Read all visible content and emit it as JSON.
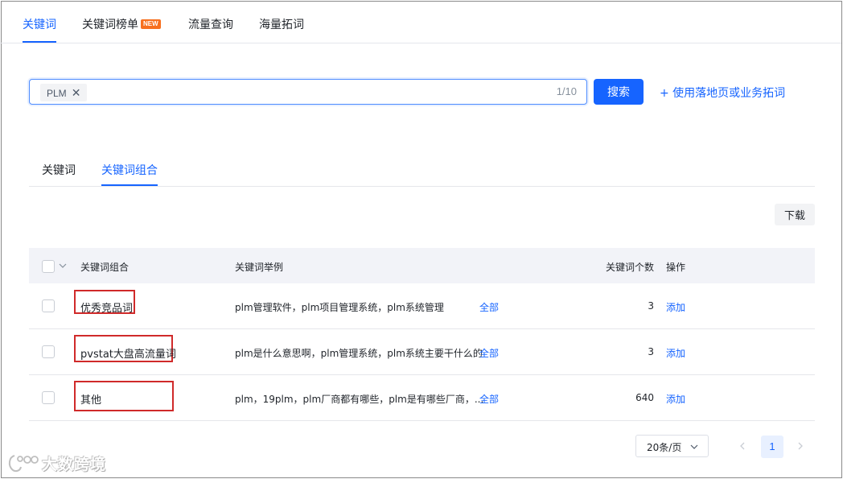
{
  "top_tabs": [
    {
      "label": "关键词",
      "active": true
    },
    {
      "label": "关键词榜单",
      "badge": "NEW"
    },
    {
      "label": "流量查询"
    },
    {
      "label": "海量拓词"
    }
  ],
  "search": {
    "tags": [
      "PLM"
    ],
    "counter": "1/10",
    "button_label": "搜索",
    "expand_link": "+ 使用落地页或业务拓词"
  },
  "sub_tabs": [
    {
      "label": "关键词"
    },
    {
      "label": "关键词组合",
      "active": true
    }
  ],
  "download_label": "下载",
  "table": {
    "headers": {
      "name": "关键词组合",
      "examples": "关键词举例",
      "count": "关键词个数",
      "op": "操作"
    },
    "rows": [
      {
        "name": "优秀竞品词",
        "examples": "plm管理软件，plm项目管理系统，plm系统管理",
        "all": "全部",
        "count": "3",
        "op": "添加"
      },
      {
        "name": "pvstat大盘高流量词",
        "examples": "plm是什么意思啊，plm管理系统，plm系统主要干什么的",
        "all": "全部",
        "count": "3",
        "op": "添加"
      },
      {
        "name": "其他",
        "examples": "plm，19plm，plm厂商都有哪些，plm是有哪些厂商，...",
        "all": "全部",
        "count": "640",
        "op": "添加"
      }
    ]
  },
  "pagination": {
    "page_size": "20条/页",
    "current_page": "1"
  },
  "watermark": "大数跨境",
  "colors": {
    "accent": "#1664ff",
    "highlight_box": "#d02a2a",
    "badge_new": "#f7701f"
  }
}
